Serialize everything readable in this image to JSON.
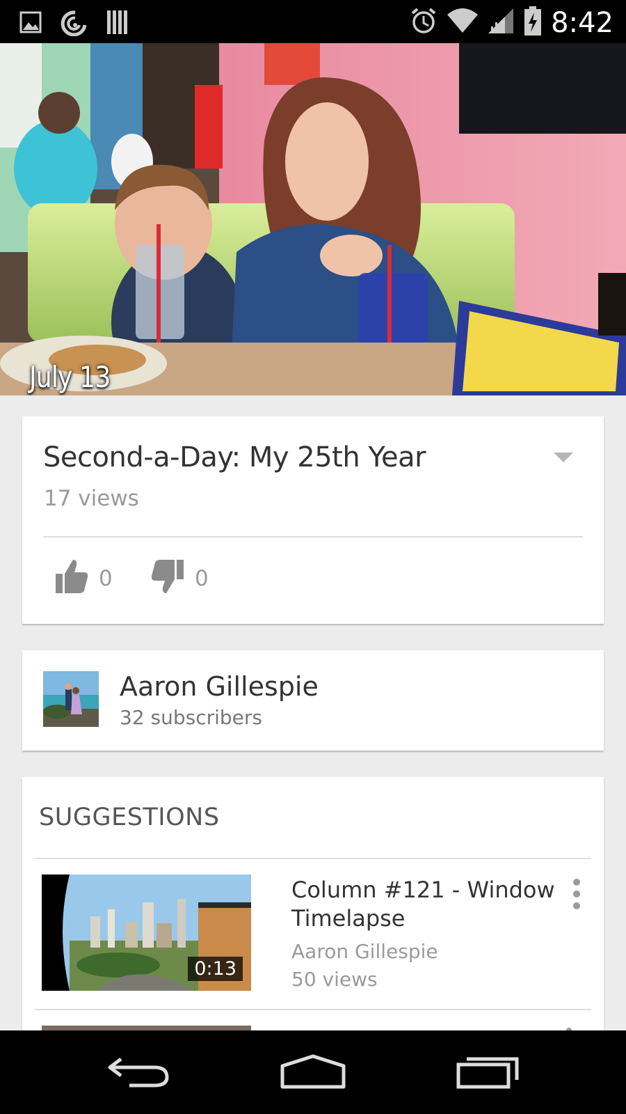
{
  "status_bar": {
    "time": "8:42",
    "left_icons": [
      "image-notification-icon",
      "sync-notification-icon",
      "barcode-notification-icon"
    ],
    "right_icons": [
      "alarm-icon",
      "wifi-icon",
      "cell-signal-icon",
      "battery-charging-icon"
    ]
  },
  "player": {
    "caption": "July 13"
  },
  "video": {
    "title": "Second-a-Day: My 25th Year",
    "views": "17 views",
    "likes": "0",
    "dislikes": "0"
  },
  "channel": {
    "name": "Aaron Gillespie",
    "subscribers": "32 subscribers"
  },
  "suggestions": {
    "heading": "SUGGESTIONS",
    "items": [
      {
        "title": "Column #121 - Window Timelapse",
        "channel": "Aaron Gillespie",
        "views": "50 views",
        "duration": "0:13"
      }
    ]
  },
  "nav_bar": {
    "buttons": [
      "back-icon",
      "home-icon",
      "recents-icon"
    ]
  },
  "colors": {
    "status_bar": "#000000",
    "background": "#ececec",
    "card": "#ffffff",
    "title_text": "#333333",
    "secondary_text": "#9a9a9a"
  }
}
